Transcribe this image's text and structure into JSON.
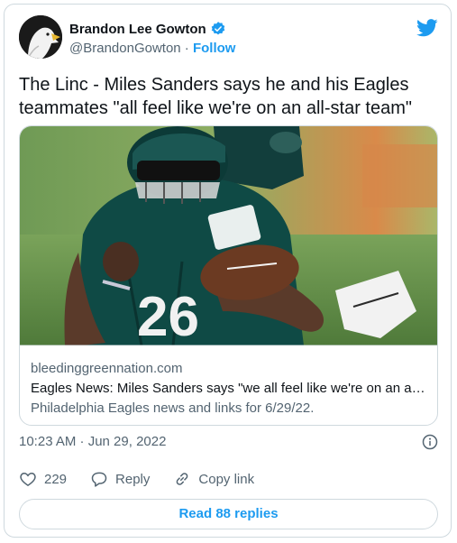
{
  "author": {
    "name": "Brandon Lee Gowton",
    "handle": "@BrandonGowton",
    "separator": " · ",
    "follow_label": "Follow"
  },
  "tweet": {
    "text": "The Linc - Miles Sanders says he and his Eagles teammates \"all feel like we're on an all-star team\""
  },
  "link_card": {
    "domain": "bleedinggreennation.com",
    "title": "Eagles News: Miles Sanders says \"we all feel like we're on an all-s...",
    "description": "Philadelphia Eagles news and links for 6/29/22."
  },
  "meta": {
    "timestamp": "10:23 AM · Jun 29, 2022"
  },
  "actions": {
    "like_count": "229",
    "reply_label": "Reply",
    "copy_link_label": "Copy link"
  },
  "footer": {
    "read_replies_label": "Read 88 replies"
  },
  "colors": {
    "accent": "#1d9bf0",
    "text": "#0f1419",
    "muted": "#536471",
    "border": "#cfd9de"
  }
}
